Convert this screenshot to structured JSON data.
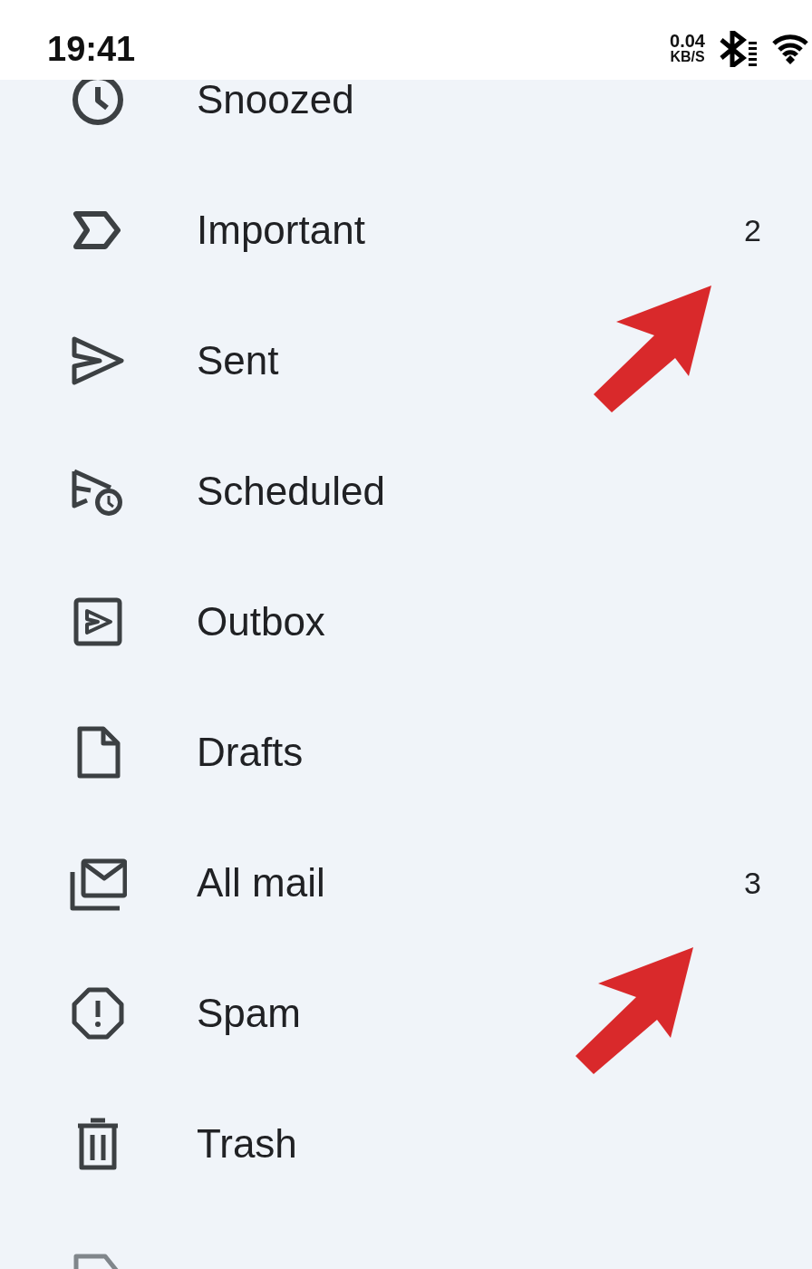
{
  "status_bar": {
    "time": "19:41",
    "speed_value": "0.04",
    "speed_unit": "KB/S"
  },
  "items": [
    {
      "label": "Snoozed"
    },
    {
      "label": "Important",
      "count": "2"
    },
    {
      "label": "Sent"
    },
    {
      "label": "Scheduled"
    },
    {
      "label": "Outbox"
    },
    {
      "label": "Drafts"
    },
    {
      "label": "All mail",
      "count": "3"
    },
    {
      "label": "Spam"
    },
    {
      "label": "Trash"
    }
  ]
}
